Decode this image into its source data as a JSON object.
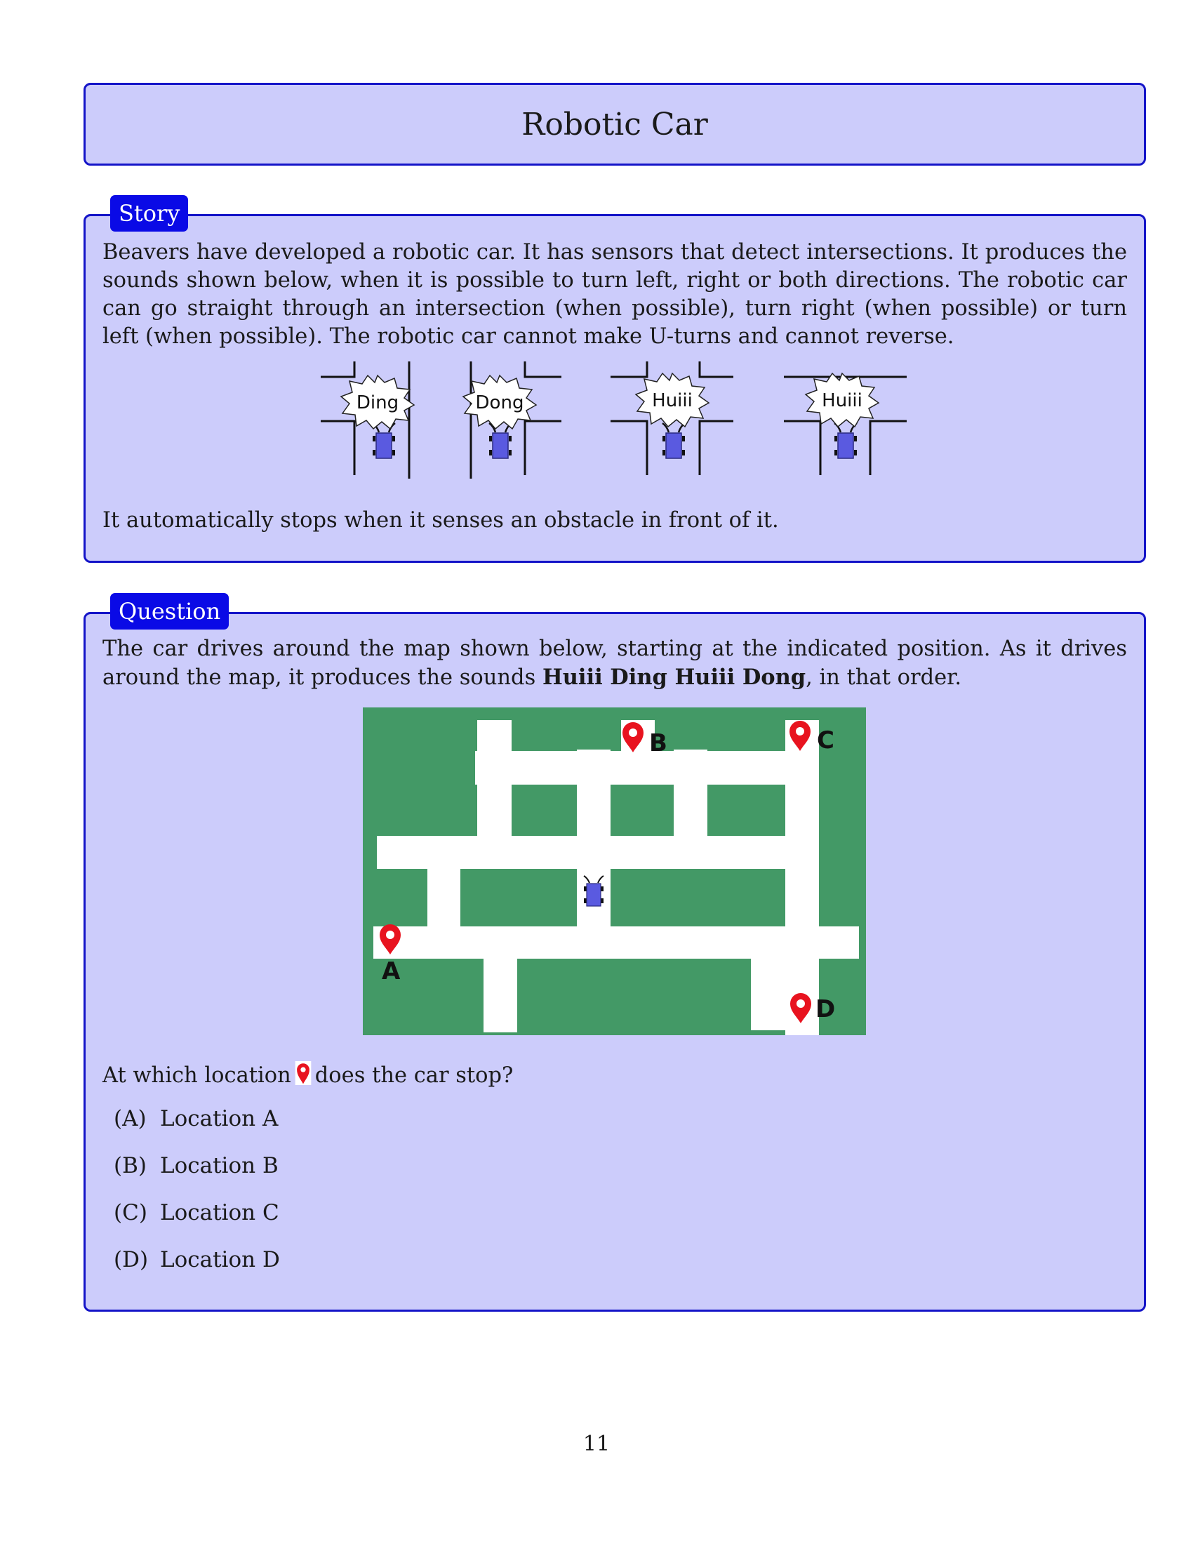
{
  "title": "Robotic Car",
  "story": {
    "tab": "Story",
    "text": "Beavers have developed a robotic car. It has sensors that detect intersections. It produces the sounds shown below, when it is possible to turn left, right or both directions. The robotic car can go straight through an intersection (when possible), turn right (when possible) or turn left (when possible). The robotic car cannot make U-turns and cannot reverse.",
    "sounds": [
      "Ding",
      "Dong",
      "Huiii",
      "Huiii"
    ],
    "text2": "It automatically stops when it senses an obstacle in front of it."
  },
  "question": {
    "tab": "Question",
    "text_before": "The car drives around the map shown below, starting at the indicated position. As it drives around the map, it produces the sounds ",
    "sequence": "Huiii Ding Huiii Dong",
    "text_after": ", in that order.",
    "map_labels": {
      "A": "A",
      "B": "B",
      "C": "C",
      "D": "D"
    },
    "ask_before": "At which location",
    "ask_after": "does the car stop?",
    "options": [
      {
        "label": "(A)",
        "text": "Location A"
      },
      {
        "label": "(B)",
        "text": "Location B"
      },
      {
        "label": "(C)",
        "text": "Location C"
      },
      {
        "label": "(D)",
        "text": "Location D"
      }
    ]
  },
  "colors": {
    "box_fill": "#ccccfb",
    "box_border": "#1414c8",
    "tab_fill": "#0a0ae6",
    "map_green": "#439966",
    "road": "#ffffff",
    "pin_red": "#e8131f",
    "car_blue": "#5a5ae0"
  },
  "icons": [
    "location-pin-icon",
    "robot-car-icon"
  ],
  "page_number": "11"
}
